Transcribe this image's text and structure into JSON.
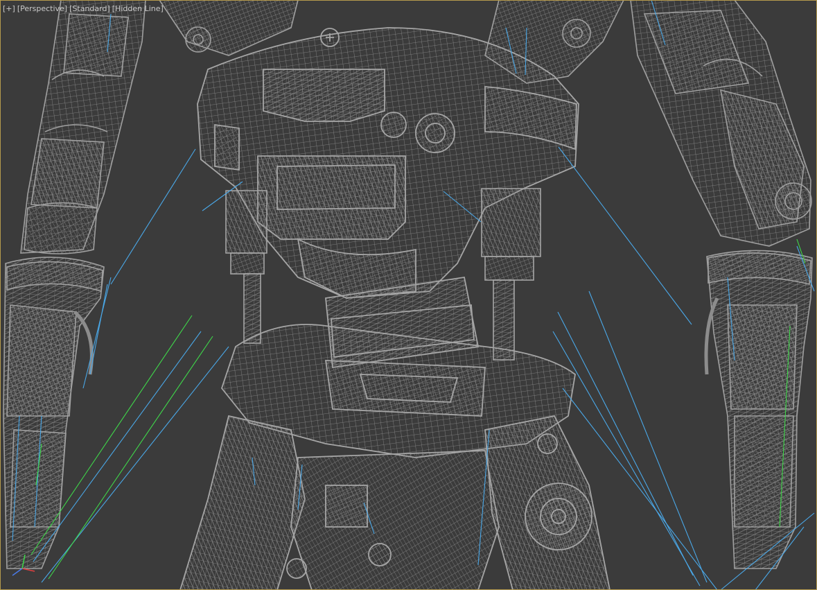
{
  "viewport": {
    "labels": {
      "menu": "[+]",
      "view": "[Perspective]",
      "shading": "[Standard]",
      "style": "[Hidden Line]"
    }
  },
  "colors": {
    "background": "#3b3b3b",
    "wireframe": "#9a9a9a",
    "wire_dense": "#7f7f7f",
    "bone_blue": "#4aa8e8",
    "bone_green": "#3fd94a",
    "active_border": "#b59a4d",
    "label_text": "#c9c9c9"
  },
  "icons": {
    "axis_gizmo": "xyz-axis-tripod-icon"
  }
}
